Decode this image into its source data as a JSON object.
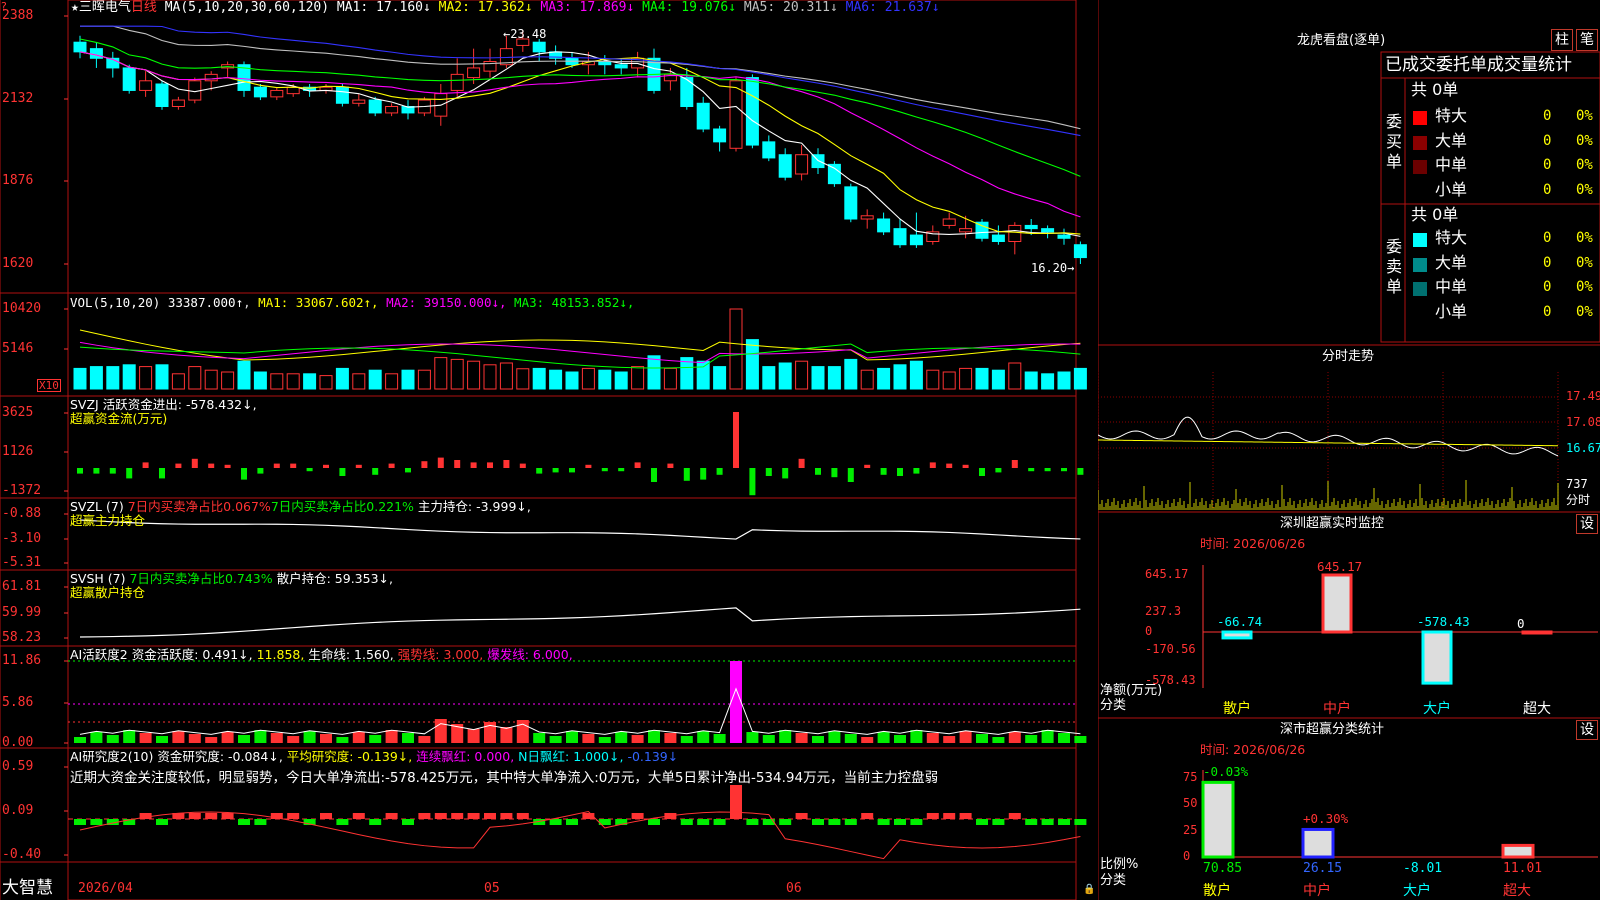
{
  "app": {
    "star": "★",
    "name": "三晖电气",
    "period": "日线",
    "brand": "大智慧",
    "corner": "?"
  },
  "main": {
    "indicator": "MA(5,10,20,30,60,120)",
    "ma": [
      {
        "label": "MA1:",
        "value": "17.160↓",
        "color": "#ffffff"
      },
      {
        "label": "MA2:",
        "value": "17.362↓",
        "color": "#ffff00"
      },
      {
        "label": "MA3:",
        "value": "17.869↓",
        "color": "#ff00ff"
      },
      {
        "label": "MA4:",
        "value": "19.076↓",
        "color": "#00ff00"
      },
      {
        "label": "MA5:",
        "value": "20.311↓",
        "color": "#c0c0c0"
      },
      {
        "label": "MA6:",
        "value": "21.637↓",
        "color": "#3333ff"
      }
    ],
    "yticks": [
      "2388",
      "2132",
      "1876",
      "1620"
    ],
    "high_label": "23.48",
    "low_label": "16.20"
  },
  "vol": {
    "name": "VOL(5,10,20)",
    "val": "33387.000↑",
    "ma": [
      {
        "label": "MA1:",
        "value": "33067.602↑",
        "color": "#ffff00"
      },
      {
        "label": "MA2:",
        "value": "39150.000↓",
        "color": "#ff00ff"
      },
      {
        "label": "MA3:",
        "value": "48153.852↓",
        "color": "#00ff00"
      }
    ],
    "yticks": [
      "10420",
      "5146"
    ],
    "unit": "X10"
  },
  "svzj": {
    "name": "SVZJ",
    "desc": "活跃资金进出:",
    "val": "-578.432↓,",
    "title": "超赢资金流(万元)",
    "yticks": [
      "3625",
      "1126",
      "-1372"
    ]
  },
  "svzl": {
    "name": "SVZL (7)",
    "t1": "7日内买卖净占比0.067%",
    "t2": "7日内买卖净占比0.221%",
    "t3": "主力持仓:",
    "val": "-3.999↓,",
    "title": "超赢主力持仓",
    "yticks": [
      "-0.88",
      "-3.10",
      "-5.31"
    ]
  },
  "svsh": {
    "name": "SVSH (7)",
    "t1": "7日内买卖净占比0.743%",
    "t3": "散户持仓:",
    "val": "59.353↓,",
    "title": "超赢散户持仓",
    "yticks": [
      "61.81",
      "59.99",
      "58.23"
    ]
  },
  "ai1": {
    "name": "AI活跃度2",
    "p1": "资金活跃度:",
    "v1": "0.491↓,",
    "v2": "11.858,",
    "p3": "生命线:",
    "v3": "1.560,",
    "p4": "强势线:",
    "v4": "3.000,",
    "p5": "爆发线:",
    "v5": "6.000,",
    "yticks": [
      "11.86",
      "5.86",
      "0.00"
    ]
  },
  "ai2": {
    "name": "AI研究度2(10)",
    "p1": "资金研究度:",
    "v1": "-0.084↓,",
    "p2": "平均研究度:",
    "v2": "-0.139↓,",
    "p3": "连续飘红:",
    "v3": "0.000,",
    "p4": "N日飘红:",
    "v4": "1.000↓,",
    "v5": "-0.139↓",
    "note": "近期大资金关注度较低，明显弱势，今日大单净流出:-578.425万元，其中特大单净流入:0万元，大单5日累计净出-534.94万元，当前主力控盘弱",
    "yticks": [
      "0.59",
      "0.09",
      "-0.40"
    ]
  },
  "xaxis": {
    "d1": "2026/04",
    "d2": "05",
    "d3": "06"
  },
  "longhu": {
    "title": "龙虎看盘(逐单)",
    "btn1": "柱",
    "btn2": "笔",
    "header": "已成交委托单成交量统计",
    "buy": {
      "side": "委买单",
      "total": "共 0单",
      "rows": [
        {
          "label": "特大",
          "vol": "0",
          "pct": "0%",
          "color": "#ff0000"
        },
        {
          "label": "大单",
          "vol": "0",
          "pct": "0%",
          "color": "#8b0000"
        },
        {
          "label": "中单",
          "vol": "0",
          "pct": "0%",
          "color": "#6b0000"
        },
        {
          "label": "小单",
          "vol": "0",
          "pct": "0%",
          "color": ""
        }
      ]
    },
    "sell": {
      "side": "委卖单",
      "total": "共 0单",
      "rows": [
        {
          "label": "特大",
          "vol": "0",
          "pct": "0%",
          "color": "#00ffff"
        },
        {
          "label": "大单",
          "vol": "0",
          "pct": "0%",
          "color": "#008b8b"
        },
        {
          "label": "中单",
          "vol": "0",
          "pct": "0%",
          "color": "#007070"
        },
        {
          "label": "小单",
          "vol": "0",
          "pct": "0%",
          "color": ""
        }
      ]
    }
  },
  "intraday": {
    "title": "分时走势",
    "yticks": [
      "17.49",
      "17.08",
      "16.67"
    ],
    "vol": "737",
    "unit": "分时"
  },
  "monitor": {
    "title": "深圳超赢实时监控",
    "btn": "设",
    "date": "时间: 2026/06/26",
    "yticks": [
      "645.17",
      "237.3",
      "0",
      "-170.56",
      "-578.43"
    ],
    "ylabel": "净额(万元)",
    "xlabel": "分类",
    "categories": [
      "散户",
      "中户",
      "大户",
      "超大"
    ],
    "values": [
      "-66.74",
      "645.17",
      "-578.43",
      "0"
    ]
  },
  "classify": {
    "title": "深市超赢分类统计",
    "btn": "设",
    "date": "时间: 2026/06/26",
    "yticks": [
      "75",
      "50",
      "25",
      "0"
    ],
    "ylabel": "比例%",
    "xlabel": "分类",
    "categories": [
      "散户",
      "中户",
      "大户",
      "超大"
    ],
    "values": [
      "70.85",
      "26.15",
      "-8.01",
      "11.01"
    ],
    "changes": [
      "-0.03%",
      "+0.30%",
      "",
      ""
    ]
  },
  "chart_data": [
    {
      "type": "candlestick",
      "title": "三晖电气 日线",
      "ylim": [
        16.2,
        23.9
      ],
      "x_labels": [
        "2026/04",
        "05",
        "06"
      ],
      "series": [
        {
          "name": "K",
          "values": [
            [
              23.1,
              22.8,
              23.3,
              22.6
            ],
            [
              22.9,
              22.6,
              23.1,
              22.3
            ],
            [
              22.6,
              22.3,
              22.8,
              22.0
            ],
            [
              22.3,
              21.6,
              22.4,
              21.5
            ],
            [
              21.6,
              21.9,
              22.2,
              21.4
            ],
            [
              21.8,
              21.1,
              21.9,
              21.0
            ],
            [
              21.1,
              21.3,
              21.4,
              21.0
            ],
            [
              21.3,
              21.9,
              22.0,
              21.2
            ],
            [
              21.9,
              22.1,
              22.2,
              21.6
            ],
            [
              22.3,
              22.4,
              22.5,
              22.0
            ],
            [
              22.4,
              21.6,
              22.5,
              21.4
            ],
            [
              21.7,
              21.4,
              21.8,
              21.3
            ],
            [
              21.4,
              21.6,
              21.7,
              21.3
            ],
            [
              21.5,
              21.7,
              21.8,
              21.4
            ],
            [
              21.7,
              21.6,
              21.8,
              21.4
            ],
            [
              21.6,
              21.7,
              21.8,
              21.5
            ],
            [
              21.7,
              21.2,
              21.8,
              21.1
            ],
            [
              21.2,
              21.3,
              21.5,
              21.1
            ],
            [
              21.3,
              20.9,
              21.4,
              20.8
            ],
            [
              20.9,
              21.1,
              21.2,
              20.8
            ],
            [
              21.1,
              20.9,
              21.3,
              20.7
            ],
            [
              20.9,
              21.3,
              21.4,
              20.8
            ],
            [
              20.8,
              21.5,
              21.8,
              20.5
            ],
            [
              21.6,
              22.1,
              22.6,
              21.4
            ],
            [
              22.0,
              22.3,
              22.9,
              21.8
            ],
            [
              22.2,
              22.5,
              22.9,
              22.0
            ],
            [
              22.4,
              22.9,
              23.3,
              22.3
            ],
            [
              23.0,
              23.2,
              23.48,
              22.8
            ],
            [
              23.1,
              22.8,
              23.2,
              22.5
            ],
            [
              22.8,
              22.6,
              23.0,
              22.4
            ],
            [
              22.6,
              22.4,
              22.8,
              22.3
            ],
            [
              22.4,
              22.5,
              22.8,
              22.1
            ],
            [
              22.5,
              22.4,
              22.7,
              22.1
            ],
            [
              22.4,
              22.3,
              22.6,
              22.1
            ],
            [
              22.3,
              22.6,
              22.8,
              22.0
            ],
            [
              22.6,
              21.6,
              22.9,
              21.5
            ],
            [
              21.9,
              22.1,
              22.3,
              21.6
            ],
            [
              22.0,
              21.1,
              22.3,
              21.0
            ],
            [
              21.2,
              20.4,
              21.4,
              20.3
            ],
            [
              20.4,
              20.0,
              20.5,
              19.7
            ],
            [
              19.8,
              21.9,
              22.0,
              19.7
            ],
            [
              22.0,
              19.9,
              22.1,
              19.8
            ],
            [
              20.0,
              19.5,
              20.2,
              19.4
            ],
            [
              19.6,
              18.9,
              19.8,
              18.8
            ],
            [
              19.0,
              19.6,
              19.9,
              18.8
            ],
            [
              19.6,
              19.2,
              19.8,
              19.0
            ],
            [
              19.3,
              18.7,
              19.4,
              18.6
            ],
            [
              18.6,
              17.6,
              18.7,
              17.5
            ],
            [
              17.6,
              17.7,
              17.9,
              17.3
            ],
            [
              17.6,
              17.2,
              17.8,
              17.1
            ],
            [
              17.3,
              16.8,
              17.6,
              16.7
            ],
            [
              17.1,
              16.8,
              17.8,
              16.7
            ],
            [
              16.9,
              17.2,
              17.4,
              16.8
            ],
            [
              17.4,
              17.6,
              17.8,
              17.3
            ],
            [
              17.2,
              17.3,
              17.7,
              17.0
            ],
            [
              17.5,
              17.0,
              17.6,
              16.9
            ],
            [
              17.1,
              16.9,
              17.4,
              16.8
            ],
            [
              16.9,
              17.4,
              17.5,
              16.5
            ],
            [
              17.4,
              17.3,
              17.6,
              17.1
            ],
            [
              17.3,
              17.2,
              17.4,
              17.0
            ],
            [
              17.1,
              17.0,
              17.3,
              16.8
            ],
            [
              16.8,
              16.4,
              16.9,
              16.2
            ]
          ]
        }
      ]
    },
    {
      "type": "bar",
      "title": "深圳超赢实时监控",
      "categories": [
        "散户",
        "中户",
        "大户",
        "超大"
      ],
      "values": [
        -66.74,
        645.17,
        -578.43,
        0
      ],
      "ylim": [
        -578.43,
        645.17
      ],
      "ylabel": "净额(万元)",
      "xlabel": "分类"
    },
    {
      "type": "bar",
      "title": "深市超赢分类统计",
      "categories": [
        "散户",
        "中户",
        "大户",
        "超大"
      ],
      "values": [
        70.85,
        26.15,
        -8.01,
        11.01
      ],
      "ylim": [
        0,
        75
      ],
      "ylabel": "比例%",
      "xlabel": "分类"
    }
  ],
  "colors": {
    "up": "#ff3333",
    "down": "#00ffff",
    "border": "#b01010",
    "green": "#00ee00",
    "yellow": "#ffff00",
    "magenta": "#ff00ff"
  }
}
